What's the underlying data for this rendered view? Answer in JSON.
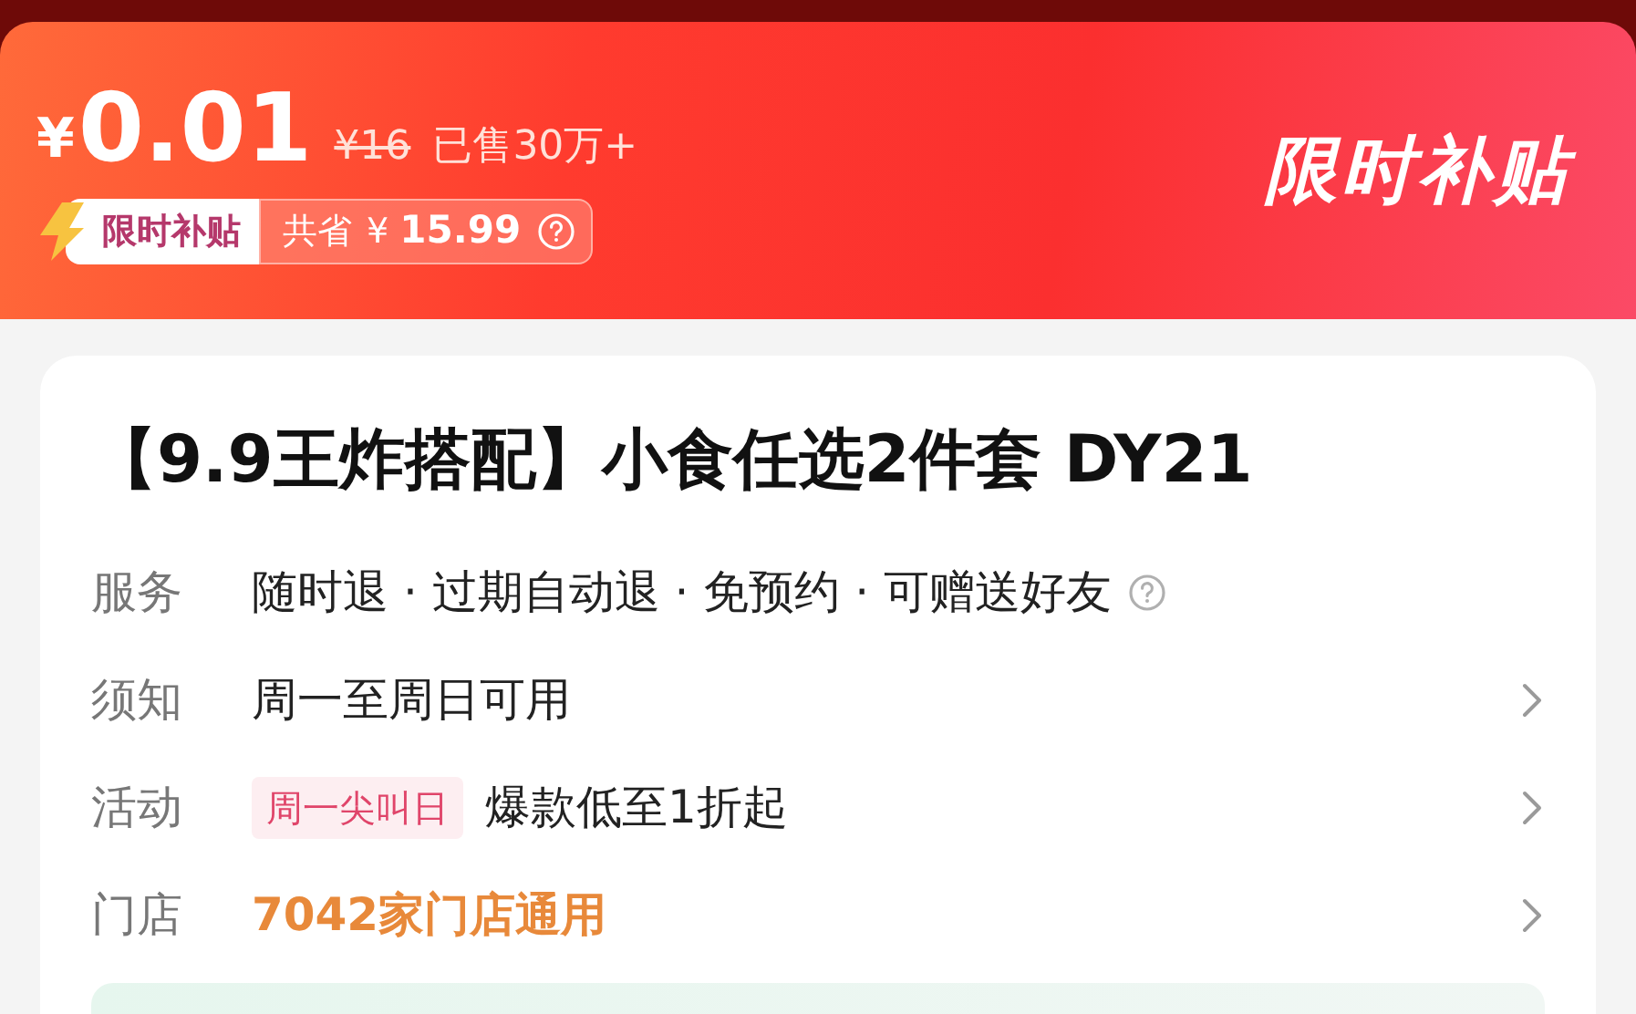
{
  "banner": {
    "currency": "¥",
    "price": "0.01",
    "original_price": "¥16",
    "sold": "已售30万+",
    "subsidy_tag": "限时补贴",
    "savings_label": "共省",
    "savings_currency": "¥",
    "savings_amount": "15.99",
    "promo_title": "限时补贴"
  },
  "product": {
    "title": "【9.9王炸搭配】小食任选2件套 DY21",
    "rows": [
      {
        "kind": "services",
        "label": "服务",
        "value": "随时退 · 过期自动退 · 免预约 · 可赠送好友",
        "chevron": false
      },
      {
        "kind": "text",
        "label": "须知",
        "value": "周一至周日可用",
        "chevron": true
      },
      {
        "kind": "tag",
        "label": "活动",
        "tag": "周一尖叫日",
        "value": "爆款低至1折起",
        "chevron": true
      },
      {
        "kind": "link",
        "label": "门店",
        "value": "7042家门店通用",
        "chevron": true
      }
    ]
  }
}
